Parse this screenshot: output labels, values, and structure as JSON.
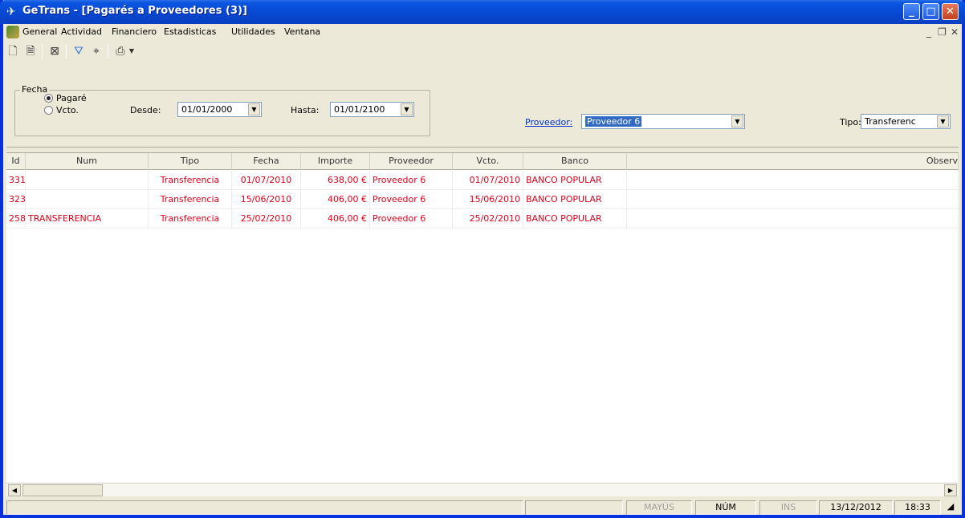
{
  "window": {
    "title": "GeTrans - [Pagarés a Proveedores (3)]",
    "min_label": "_",
    "max_label": "□",
    "close_label": "✕"
  },
  "menu": {
    "items": [
      "General",
      "Actividad",
      "Financiero",
      "Estadisticas",
      "Utilidades",
      "Ventana"
    ],
    "mdi_min": "_",
    "mdi_restore": "❐",
    "mdi_close": "✕"
  },
  "toolbar": {
    "icons": [
      "new-document-icon",
      "properties-icon",
      "delete-icon",
      "filter-icon",
      "binoculars-icon",
      "print-icon"
    ]
  },
  "filters": {
    "group_label": "Fecha",
    "radio_pagare": "Pagaré",
    "radio_vcto": "Vcto.",
    "desde_label": "Desde:",
    "desde_value": "01/01/2000",
    "hasta_label": "Hasta:",
    "hasta_value": "01/01/2100",
    "proveedor_label": "Proveedor:",
    "proveedor_value": "Proveedor 6",
    "tipo_label": "Tipo:",
    "tipo_value": "Transferenc"
  },
  "table": {
    "headers": [
      "Id",
      "Num",
      "Tipo",
      "Fecha",
      "Importe",
      "Proveedor",
      "Vcto.",
      "Banco",
      "Observ"
    ],
    "rows": [
      [
        "331",
        "",
        "Transferencia",
        "01/07/2010",
        "638,00 €",
        "Proveedor 6",
        "01/07/2010",
        "BANCO POPULAR"
      ],
      [
        "323",
        "",
        "Transferencia",
        "15/06/2010",
        "406,00 €",
        "Proveedor 6",
        "15/06/2010",
        "BANCO POPULAR"
      ],
      [
        "258",
        "TRANSFERENCIA",
        "Transferencia",
        "25/02/2010",
        "406,00 €",
        "Proveedor 6",
        "25/02/2010",
        "BANCO POPULAR"
      ]
    ],
    "row_color": "#e0001a"
  },
  "status": {
    "mayus": "MAYÚS",
    "num": "NÚM",
    "ins": "INS",
    "date": "13/12/2012",
    "time": "18:33"
  }
}
